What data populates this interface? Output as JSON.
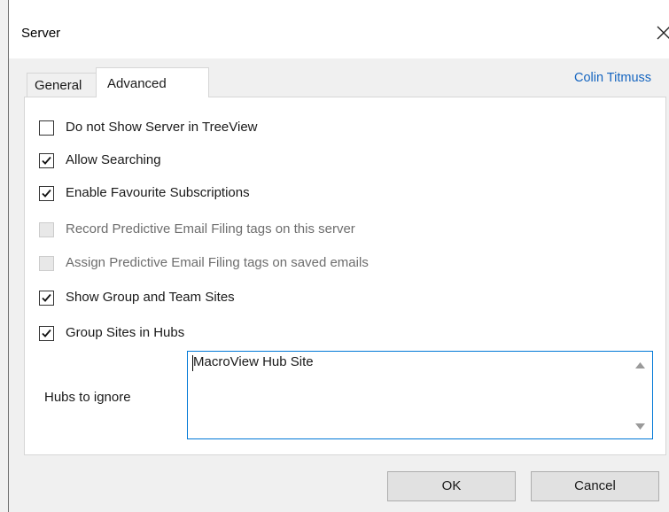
{
  "window": {
    "title": "Server",
    "close_icon": "close-icon"
  },
  "user": {
    "name": "Colin Titmuss",
    "color": "#1565c0"
  },
  "tabs": [
    {
      "label": "General",
      "selected": false
    },
    {
      "label": "Advanced",
      "selected": true
    }
  ],
  "options": [
    {
      "label": "Do not Show Server in TreeView",
      "checked": false,
      "enabled": true
    },
    {
      "label": "Allow Searching",
      "checked": true,
      "enabled": true
    },
    {
      "label": "Enable Favourite Subscriptions",
      "checked": true,
      "enabled": true
    },
    {
      "label": "Record Predictive Email Filing tags on this server",
      "checked": false,
      "enabled": false
    },
    {
      "label": "Assign Predictive Email Filing tags on saved emails",
      "checked": false,
      "enabled": false
    },
    {
      "label": "Show Group and Team Sites",
      "checked": true,
      "enabled": true
    },
    {
      "label": "Group Sites in Hubs",
      "checked": true,
      "enabled": true
    }
  ],
  "hubs": {
    "label": "Hubs to ignore",
    "value": "MacroView Hub Site"
  },
  "buttons": {
    "ok": "OK",
    "cancel": "Cancel"
  },
  "colors": {
    "accent": "#0078d7",
    "link": "#1565c0"
  }
}
